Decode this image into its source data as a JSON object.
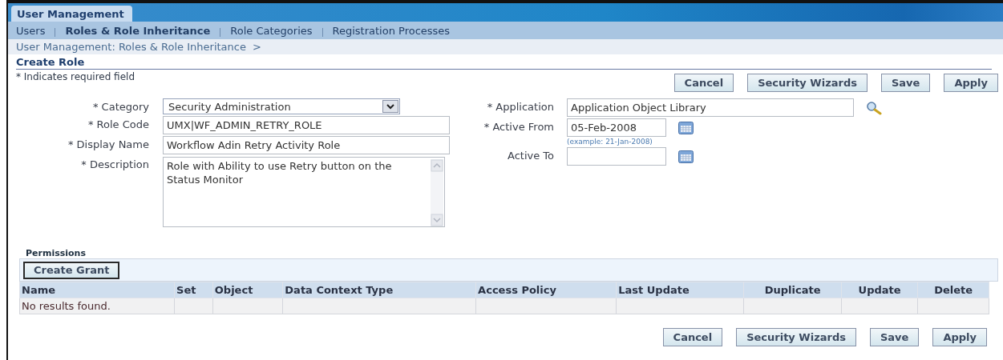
{
  "header_tab": {
    "label": "User Management"
  },
  "nav": [
    {
      "label": "Users",
      "selected": false
    },
    {
      "label": "Roles & Role Inheritance",
      "selected": true
    },
    {
      "label": "Role Categories",
      "selected": false
    },
    {
      "label": "Registration Processes",
      "selected": false
    }
  ],
  "breadcrumb": {
    "link": "User Management: Roles & Role Inheritance",
    "separator": ">"
  },
  "page_title": "Create Role",
  "required_note": "* Indicates required field",
  "buttons_top": [
    "Cancel",
    "Security Wizards",
    "Save",
    "Apply"
  ],
  "form_left": [
    {
      "kind": "select",
      "label": "* Category",
      "value": "Security Administration"
    },
    {
      "kind": "text",
      "label": "* Role Code",
      "value": "UMX|WF_ADMIN_RETRY_ROLE"
    },
    {
      "kind": "text",
      "label": "* Display Name",
      "value": "Workflow Adin Retry Activity Role"
    },
    {
      "kind": "textarea",
      "label": "* Description",
      "value": "Role with Ability to use Retry button on the Status Monitor"
    }
  ],
  "form_right": [
    {
      "kind": "lookup",
      "label": "* Application",
      "value": "Application Object Library"
    },
    {
      "kind": "date",
      "label": "* Active From",
      "value": "05-Feb-2008",
      "hint": "(example: 21-Jan-2008)"
    },
    {
      "kind": "date",
      "label": "Active To"
    }
  ],
  "permissions": {
    "title": "Permissions",
    "button": "Create Grant",
    "columns": [
      "Name",
      "Set",
      "Object",
      "Data Context Type",
      "Access Policy",
      "Last Update",
      "Duplicate",
      "Update",
      "Delete"
    ],
    "empty_text": "No results found."
  },
  "buttons_bottom": [
    "Cancel",
    "Security Wizards",
    "Save",
    "Apply"
  ]
}
